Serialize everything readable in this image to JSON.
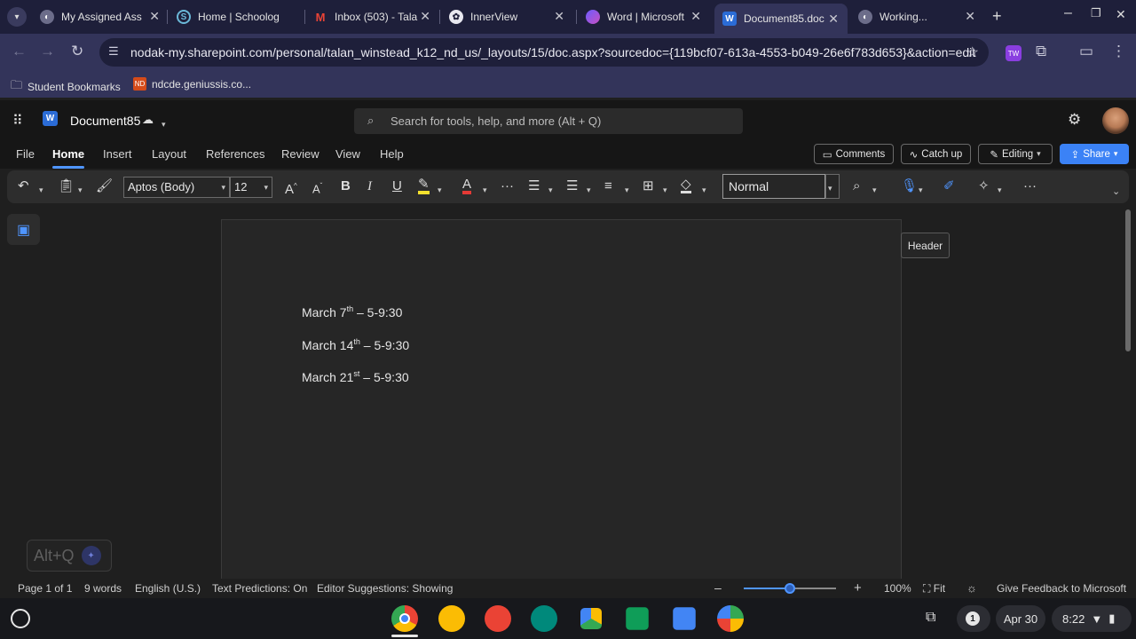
{
  "browser": {
    "tabs": [
      {
        "title": "My Assigned Ass",
        "icon": "globe-icon"
      },
      {
        "title": "Home | Schoolog",
        "icon": "schoology-icon"
      },
      {
        "title": "Inbox (503) - Tala",
        "icon": "gmail-icon"
      },
      {
        "title": "InnerView",
        "icon": "innerview-icon"
      },
      {
        "title": "Word | Microsoft",
        "icon": "copilot-icon"
      },
      {
        "title": "Document85.doc",
        "icon": "word-icon"
      },
      {
        "title": "Working...",
        "icon": "globe-icon"
      }
    ],
    "url": "nodak-my.sharepoint.com/personal/talan_winstead_k12_nd_us/_layouts/15/doc.aspx?sourcedoc={119bcf07-613a-4553-b049-26e6f783d653}&action=edit",
    "bookmarks": [
      {
        "label": "Student Bookmarks"
      },
      {
        "label": "ndcde.geniussis.co..."
      }
    ]
  },
  "word": {
    "doc_title": "Document85",
    "search_placeholder": "Search for tools, help, and more (Alt + Q)",
    "menus": [
      "File",
      "Home",
      "Insert",
      "Layout",
      "References",
      "Review",
      "View",
      "Help"
    ],
    "active_menu": "Home",
    "buttons": {
      "comments": "Comments",
      "catchup": "Catch up",
      "editing": "Editing",
      "share": "Share"
    },
    "font_name": "Aptos (Body)",
    "font_size": "12",
    "style": "Normal",
    "header_tooltip": "Header",
    "paragraphs": [
      {
        "pre": "March 7",
        "sup": "th",
        "post": " – 5-9:30"
      },
      {
        "pre": "March 14",
        "sup": "th",
        "post": " – 5-9:30"
      },
      {
        "pre": "March 21",
        "sup": "st",
        "post": " – 5-9:30"
      }
    ],
    "altq": "Alt+Q",
    "status": {
      "page": "Page 1 of 1",
      "words": "9 words",
      "language": "English (U.S.)",
      "predictions": "Text Predictions: On",
      "editor": "Editor Suggestions: Showing",
      "zoom": "100%",
      "fit": "Fit",
      "feedback": "Give Feedback to Microsoft"
    },
    "zoom_level": 0.5
  },
  "shelf": {
    "date": "Apr 30",
    "time": "8:22",
    "notification_count": "1"
  }
}
